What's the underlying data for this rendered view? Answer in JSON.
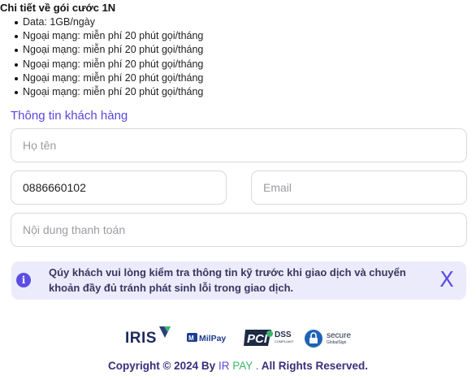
{
  "plan": {
    "title": "Chi tiết về gói cước 1N",
    "items": [
      "Data: 1GB/ngày",
      "Ngoại mạng: miễn phí 20 phút gọi/tháng",
      "Ngoại mạng: miễn phí 20 phút gọi/tháng",
      "Ngoại mạng: miễn phí 20 phút gọi/tháng",
      "Ngoại mạng: miễn phí 20 phút gọi/tháng",
      "Ngoại mạng: miễn phí 20 phút gọi/tháng"
    ]
  },
  "customer": {
    "section_title": "Thông tin khách hàng",
    "name": {
      "value": "",
      "placeholder": "Họ tên"
    },
    "phone": {
      "value": "0886660102",
      "placeholder": ""
    },
    "email": {
      "value": "",
      "placeholder": "Email"
    },
    "content": {
      "value": "",
      "placeholder": "Nội dung thanh toán"
    }
  },
  "notice": {
    "icon": "info-icon",
    "text": "Qúy khách vui lòng kiểm tra thông tin kỹ trước khi giao dịch và chuyển khoản đầy đủ tránh phát sinh lỗi trong giao dịch.",
    "close_label": "X"
  },
  "logos": {
    "iris": "IRIS",
    "milpay": "MilPay",
    "pci": "PCI",
    "pci_sub": "DSS",
    "pci_sub2": "COMPLIANT",
    "secure": "secure",
    "secure_sub": "GlobalSign"
  },
  "footer": {
    "prefix": "Copyright © 2024 By ",
    "brand_ir": "IR",
    "brand_pay": " PAY",
    "brand_dot": " .",
    "suffix": " All Rights Reserved."
  },
  "colors": {
    "accent": "#5847e0",
    "notice_bg": "#ecebfb",
    "pay_green": "#3fb56b",
    "footer_text": "#3a2e7a"
  }
}
